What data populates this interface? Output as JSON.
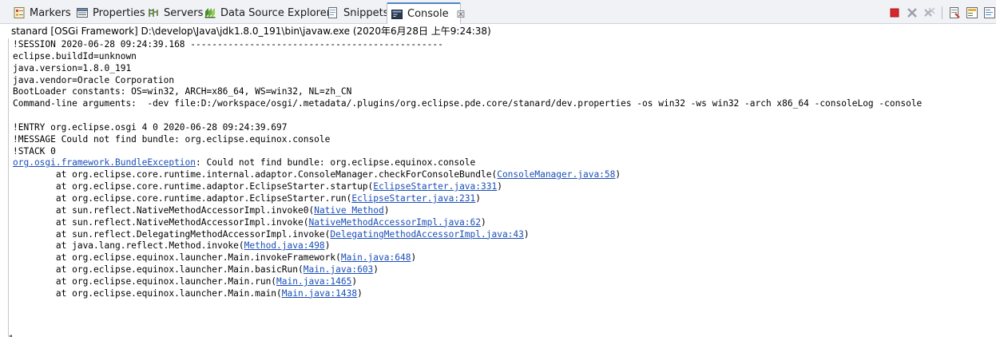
{
  "tabs": [
    {
      "label": "Markers",
      "icon": "markers-icon"
    },
    {
      "label": "Properties",
      "icon": "properties-icon"
    },
    {
      "label": "Servers",
      "icon": "servers-icon"
    },
    {
      "label": "Data Source Explorer",
      "icon": "data-source-icon"
    },
    {
      "label": "Snippets",
      "icon": "snippets-icon"
    },
    {
      "label": "Console",
      "icon": "console-icon",
      "active": true,
      "close": "☒"
    }
  ],
  "description": "stanard [OSGi Framework] D:\\develop\\Java\\jdk1.8.0_191\\bin\\javaw.exe (2020年6月28日 上午9:24:38)",
  "console": {
    "l1": "!SESSION 2020-06-28 09:24:39.168 -----------------------------------------------",
    "l2": "eclipse.buildId=unknown",
    "l3": "java.version=1.8.0_191",
    "l4": "java.vendor=Oracle Corporation",
    "l5": "BootLoader constants: OS=win32, ARCH=x86_64, WS=win32, NL=zh_CN",
    "l6": "Command-line arguments:  -dev file:D:/workspace/osgi/.metadata/.plugins/org.eclipse.pde.core/stanard/dev.properties -os win32 -ws win32 -arch x86_64 -consoleLog -console",
    "l7": "",
    "l8": "!ENTRY org.eclipse.osgi 4 0 2020-06-28 09:24:39.697",
    "l9": "!MESSAGE Could not find bundle: org.eclipse.equinox.console",
    "l10": "!STACK 0",
    "exception_class": "org.osgi.framework.BundleException",
    "exception_msg": ": Could not find bundle: org.eclipse.equinox.console",
    "stack": [
      {
        "prefix": "\tat org.eclipse.core.runtime.internal.adaptor.ConsoleManager.checkForConsoleBundle(",
        "link": "ConsoleManager.java:58",
        "suffix": ")"
      },
      {
        "prefix": "\tat org.eclipse.core.runtime.adaptor.EclipseStarter.startup(",
        "link": "EclipseStarter.java:331",
        "suffix": ")"
      },
      {
        "prefix": "\tat org.eclipse.core.runtime.adaptor.EclipseStarter.run(",
        "link": "EclipseStarter.java:231",
        "suffix": ")"
      },
      {
        "prefix": "\tat sun.reflect.NativeMethodAccessorImpl.invoke0(",
        "link": "Native Method",
        "suffix": ")"
      },
      {
        "prefix": "\tat sun.reflect.NativeMethodAccessorImpl.invoke(",
        "link": "NativeMethodAccessorImpl.java:62",
        "suffix": ")"
      },
      {
        "prefix": "\tat sun.reflect.DelegatingMethodAccessorImpl.invoke(",
        "link": "DelegatingMethodAccessorImpl.java:43",
        "suffix": ")"
      },
      {
        "prefix": "\tat java.lang.reflect.Method.invoke(",
        "link": "Method.java:498",
        "suffix": ")"
      },
      {
        "prefix": "\tat org.eclipse.equinox.launcher.Main.invokeFramework(",
        "link": "Main.java:648",
        "suffix": ")"
      },
      {
        "prefix": "\tat org.eclipse.equinox.launcher.Main.basicRun(",
        "link": "Main.java:603",
        "suffix": ")"
      },
      {
        "prefix": "\tat org.eclipse.equinox.launcher.Main.run(",
        "link": "Main.java:1465",
        "suffix": ")"
      },
      {
        "prefix": "\tat org.eclipse.equinox.launcher.Main.main(",
        "link": "Main.java:1438",
        "suffix": ")"
      }
    ]
  },
  "colors": {
    "link": "#1a4fb8",
    "terminate": "#d9262b",
    "active_tab_accent": "#4f86c6"
  },
  "toolbar_icons": [
    "terminate-icon",
    "remove-launch-icon",
    "remove-all-terminated-icon",
    "clear-console-icon",
    "scroll-lock-icon",
    "word-wrap-icon"
  ]
}
